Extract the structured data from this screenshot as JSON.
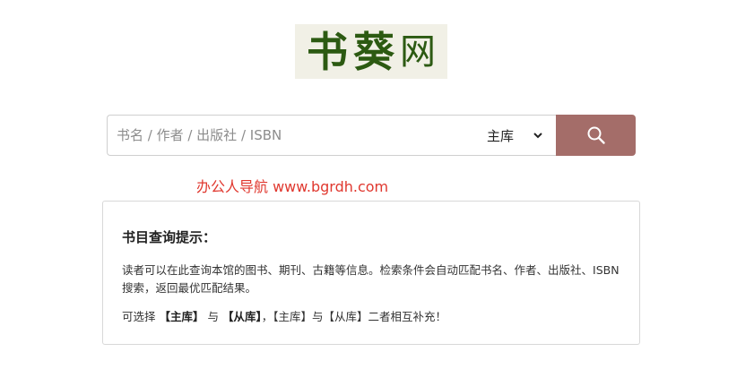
{
  "logo": {
    "char1": "书",
    "char2": "葵",
    "char3": "网"
  },
  "search": {
    "placeholder": "书名 / 作者 / 出版社 / ISBN",
    "value": "",
    "library_selected": "主库",
    "button_icon": "search-icon"
  },
  "promo": {
    "text": "办公人导航 www.bgrdh.com"
  },
  "tips": {
    "title": "书目查询提示：",
    "body": "读者可以在此查询本馆的图书、期刊、古籍等信息。检索条件会自动匹配书名、作者、出版社、ISBN搜索，返回最优匹配结果。",
    "note_prefix": "可选择 ",
    "option_main": "【主库】",
    "note_and": " 与 ",
    "option_secondary": "【从库】",
    "note_suffix": "，【主库】与【从库】二者相互补充！"
  },
  "colors": {
    "logo_green": "#2c5a12",
    "button_bg": "#a46d69",
    "promo_red": "#e0382f"
  }
}
